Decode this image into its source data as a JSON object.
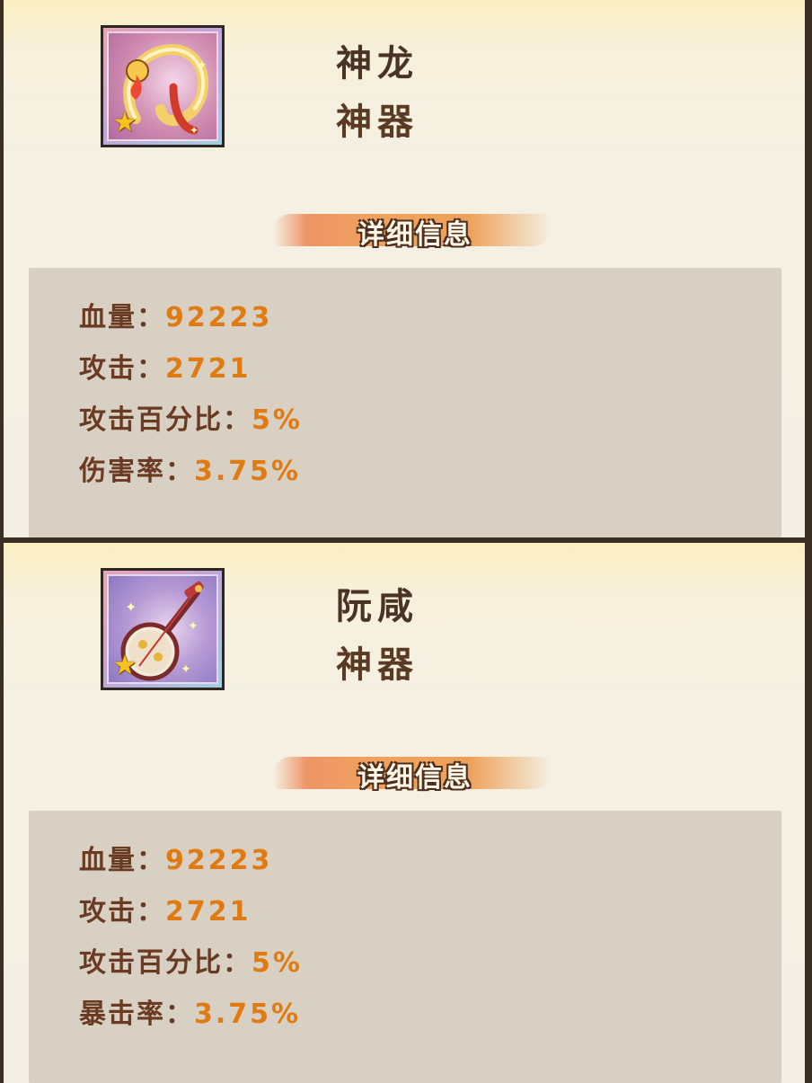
{
  "cards": [
    {
      "icon": "dragon-icon",
      "name": "神龙",
      "type": "神器",
      "section_title": "详细信息",
      "stats": [
        {
          "label": "血量：",
          "value": "92223"
        },
        {
          "label": "攻击：",
          "value": "2721"
        },
        {
          "label": "攻击百分比：",
          "value": "5%"
        },
        {
          "label": "伤害率：",
          "value": "3.75%"
        }
      ]
    },
    {
      "icon": "pipa-lute-icon",
      "name": "阮咸",
      "type": "神器",
      "section_title": "详细信息",
      "stats": [
        {
          "label": "血量：",
          "value": "92223"
        },
        {
          "label": "攻击：",
          "value": "2721"
        },
        {
          "label": "攻击百分比：",
          "value": "5%"
        },
        {
          "label": "暴击率：",
          "value": "3.75%"
        }
      ]
    }
  ],
  "colors": {
    "label": "#6a3a22",
    "value": "#e07a12",
    "panel": "#d8d0c2",
    "card": "#f4f0e3"
  }
}
